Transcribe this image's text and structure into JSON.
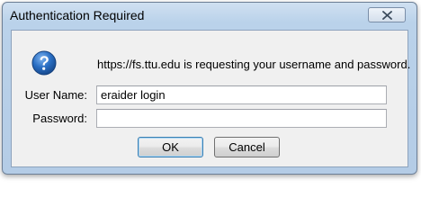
{
  "window": {
    "title": "Authentication Required"
  },
  "dialog": {
    "message": "https://fs.ttu.edu is requesting your username and password.",
    "icon": "info-icon",
    "username_label": "User Name:",
    "username_value": "eraider login",
    "password_label": "Password:",
    "password_value": "",
    "ok_label": "OK",
    "cancel_label": "Cancel"
  },
  "colors": {
    "frame": "#bad2ea",
    "client": "#f0f0f0",
    "icon_blue": "#2a6fc4",
    "default_button_border": "#3c7fb1"
  }
}
